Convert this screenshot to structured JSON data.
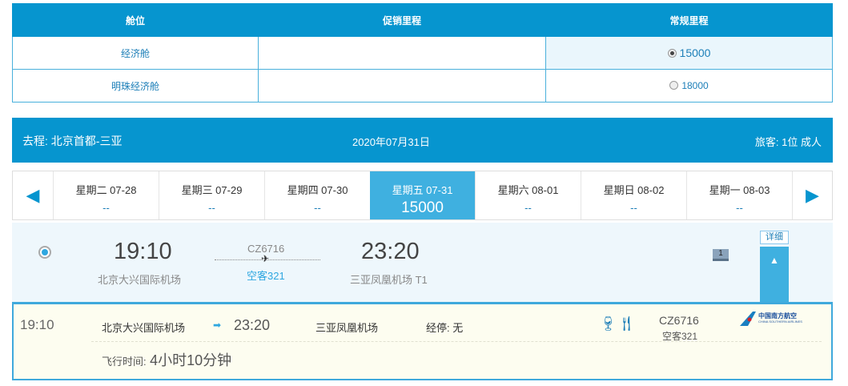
{
  "cabin_table": {
    "headers": [
      "舱位",
      "促销里程",
      "常规里程"
    ],
    "rows": [
      {
        "cabin": "经济舱",
        "promo": "",
        "regular": "15000",
        "selected": true
      },
      {
        "cabin": "明珠经济舱",
        "promo": "",
        "regular": "18000",
        "selected": false
      }
    ]
  },
  "banner": {
    "route": "去程: 北京首都-三亚",
    "date": "2020年07月31日",
    "passengers": "旅客: 1位 成人"
  },
  "days": [
    {
      "label": "星期二 07-28",
      "price": "--"
    },
    {
      "label": "星期三 07-29",
      "price": "--"
    },
    {
      "label": "星期四 07-30",
      "price": "--"
    },
    {
      "label": "星期五 07-31",
      "price": "15000",
      "selected": true
    },
    {
      "label": "星期六 08-01",
      "price": "--"
    },
    {
      "label": "星期日 08-02",
      "price": "--"
    },
    {
      "label": "星期一 08-03",
      "price": "--"
    }
  ],
  "flight": {
    "dep_time": "19:10",
    "dep_airport": "北京大兴国际机场",
    "flight_no": "CZ6716",
    "aircraft": "空客321",
    "arr_time": "23:20",
    "arr_airport": "三亚凤凰机场 T1",
    "seats": "1",
    "detail_label": "详细"
  },
  "detail": {
    "dep_time": "19:10",
    "dep_airport": "北京大兴国际机场",
    "arr_time": "23:20",
    "arr_airport": "三亚凤凰机场",
    "stops": "经停: 无",
    "flight_no": "CZ6716",
    "aircraft": "空客321",
    "duration_label": "飞行时间:",
    "duration": "4小时10分钟",
    "airline_logo": "中国南方航空",
    "airline_logo_en": "CHINA SOUTHERN AIRLINES"
  },
  "colors": {
    "primary": "#0695cf",
    "accent": "#3fb0e0"
  }
}
